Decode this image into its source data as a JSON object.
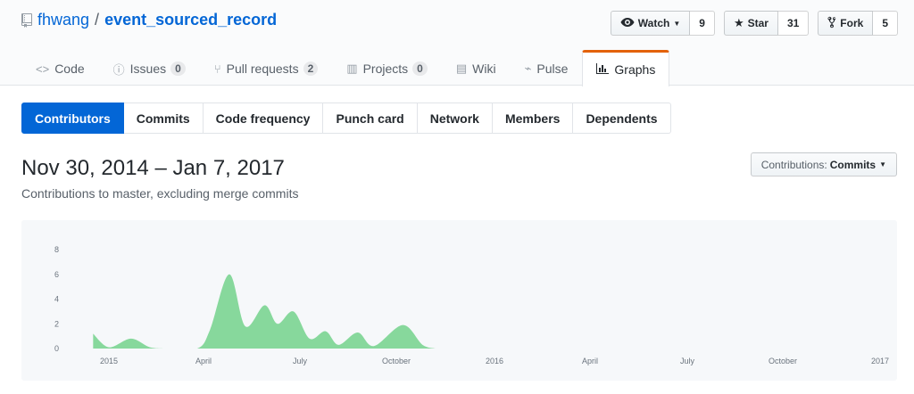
{
  "repo": {
    "owner": "fhwang",
    "separator": "/",
    "name": "event_sourced_record"
  },
  "actions": [
    {
      "label": "Watch",
      "icon": "eye-icon",
      "count": "9",
      "has_caret": true
    },
    {
      "label": "Star",
      "icon": "star-icon",
      "count": "31",
      "has_caret": false
    },
    {
      "label": "Fork",
      "icon": "fork-icon",
      "count": "5",
      "has_caret": false
    }
  ],
  "reponav": [
    {
      "label": "Code",
      "icon": "code-icon",
      "counter": null
    },
    {
      "label": "Issues",
      "icon": "issue-icon",
      "counter": "0"
    },
    {
      "label": "Pull requests",
      "icon": "pull-request-icon",
      "counter": "2"
    },
    {
      "label": "Projects",
      "icon": "project-icon",
      "counter": "0"
    },
    {
      "label": "Wiki",
      "icon": "book-icon",
      "counter": null
    },
    {
      "label": "Pulse",
      "icon": "pulse-icon",
      "counter": null
    },
    {
      "label": "Graphs",
      "icon": "graph-icon",
      "counter": null,
      "selected": true
    }
  ],
  "subnav": [
    "Contributors",
    "Commits",
    "Code frequency",
    "Punch card",
    "Network",
    "Members",
    "Dependents"
  ],
  "subnav_selected": "Contributors",
  "date_range": "Nov 30, 2014 – Jan 7, 2017",
  "subtitle": "Contributions to master, excluding merge commits",
  "contributions_select": {
    "prefix": "Contributions:",
    "value": "Commits"
  },
  "colors": {
    "accent_orange": "#e36209",
    "selected_blue": "#0366d6",
    "area_green": "#2cbe4e"
  },
  "chart_data": {
    "type": "area",
    "y_ticks": [
      "0",
      "2",
      "4",
      "6",
      "8"
    ],
    "ylim": [
      0,
      8
    ],
    "x_ticks": [
      "2015",
      "April",
      "July",
      "October",
      "2016",
      "April",
      "July",
      "October",
      "2017"
    ],
    "series": [
      {
        "values": [
          [
            -0.5,
            1.2
          ],
          [
            0,
            0.1
          ],
          [
            0.7,
            0.8
          ],
          [
            1.3,
            0.1
          ],
          [
            1.8,
            0
          ],
          [
            2.8,
            0
          ],
          [
            3.2,
            1.5
          ],
          [
            3.8,
            6
          ],
          [
            4.3,
            1.8
          ],
          [
            4.9,
            3.5
          ],
          [
            5.3,
            2.0
          ],
          [
            5.8,
            3.0
          ],
          [
            6.3,
            0.8
          ],
          [
            6.8,
            1.4
          ],
          [
            7.2,
            0.3
          ],
          [
            7.8,
            1.3
          ],
          [
            8.3,
            0.2
          ],
          [
            9.2,
            1.9
          ],
          [
            9.8,
            0.3
          ],
          [
            10.2,
            0
          ]
        ]
      }
    ]
  }
}
